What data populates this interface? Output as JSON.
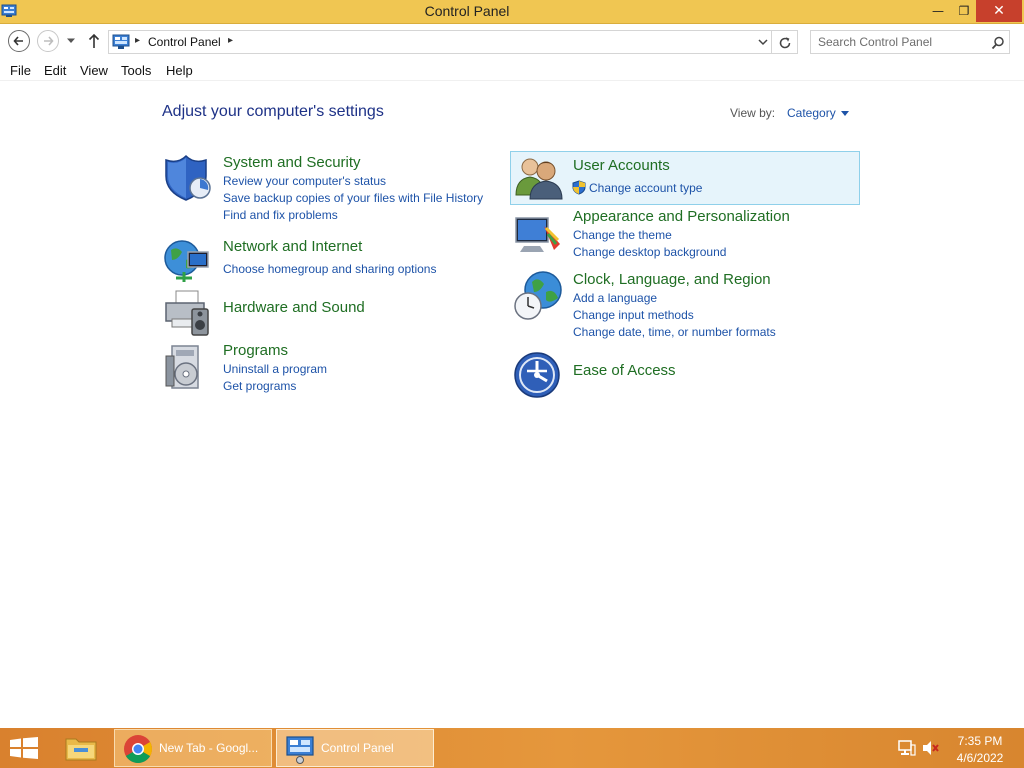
{
  "window": {
    "title": "Control Panel",
    "min_label": "—",
    "max_label": "❐",
    "close_label": "✕"
  },
  "nav": {
    "breadcrumb": "Control Panel",
    "search_placeholder": "Search Control Panel"
  },
  "menu": [
    "File",
    "Edit",
    "View",
    "Tools",
    "Help"
  ],
  "main": {
    "heading": "Adjust your computer's settings",
    "view_by_label": "View by:",
    "view_by_value": "Category"
  },
  "categories": {
    "system": {
      "title": "System and Security",
      "links": [
        "Review your computer's status",
        "Save backup copies of your files with File History",
        "Find and fix problems"
      ]
    },
    "network": {
      "title": "Network and Internet",
      "links": [
        "Choose homegroup and sharing options"
      ]
    },
    "hardware": {
      "title": "Hardware and Sound"
    },
    "programs": {
      "title": "Programs",
      "links": [
        "Uninstall a program",
        "Get programs"
      ]
    },
    "users": {
      "title": "User Accounts",
      "links": [
        "Change account type"
      ]
    },
    "appearance": {
      "title": "Appearance and Personalization",
      "links": [
        "Change the theme",
        "Change desktop background"
      ]
    },
    "clock": {
      "title": "Clock, Language, and Region",
      "links": [
        "Add a language",
        "Change input methods",
        "Change date, time, or number formats"
      ]
    },
    "ease": {
      "title": "Ease of Access"
    }
  },
  "taskbar": {
    "chrome_label": "New Tab - Googl...",
    "cpanel_label": "Control Panel",
    "time": "7:35 PM",
    "date": "4/6/2022"
  },
  "colors": {
    "titlebar": "#f0c652",
    "taskbar": "#e5973c",
    "link": "#1e53a8",
    "category_title": "#1f6e23",
    "heading": "#1e3287"
  }
}
